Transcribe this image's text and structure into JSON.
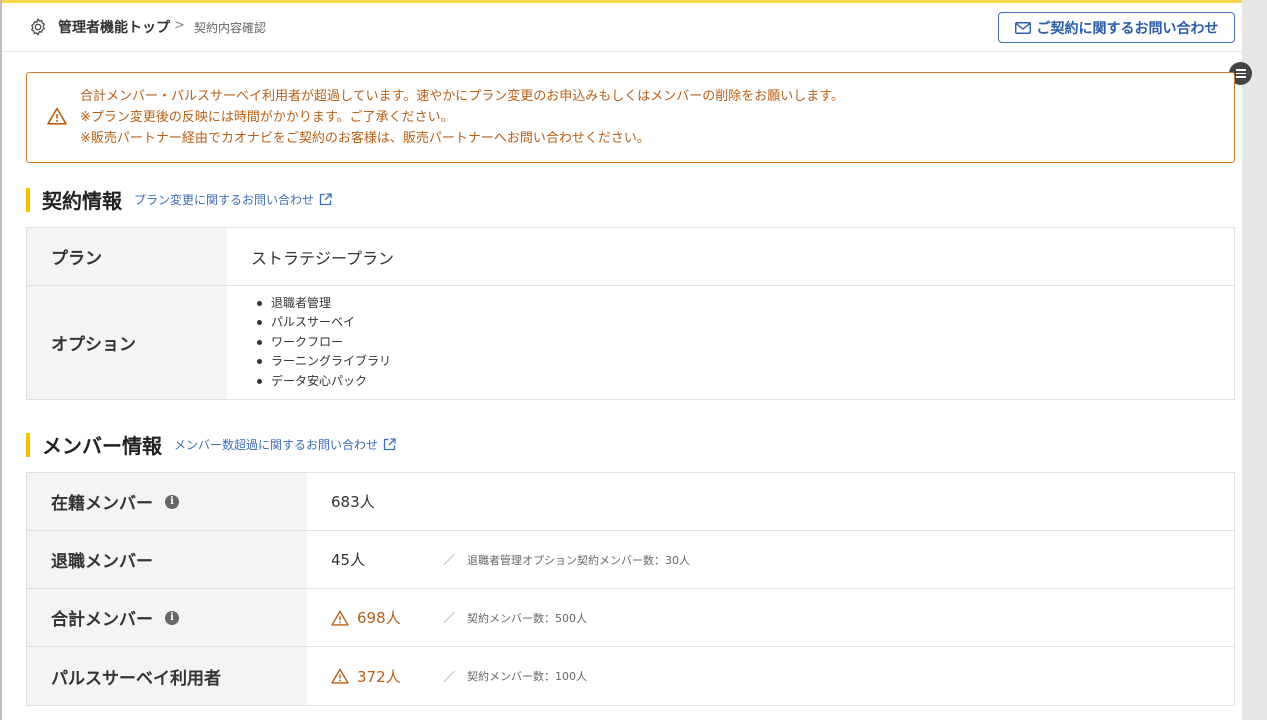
{
  "header": {
    "breadcrumb_root": "管理者機能トップ",
    "breadcrumb_separator": ">",
    "breadcrumb_current": "契約内容確認",
    "contact_button_label": "ご契約に関するお問い合わせ"
  },
  "alert": {
    "lines": [
      "合計メンバー・パルスサーベイ利用者が超過しています。速やかにプラン変更のお申込みもしくはメンバーの削除をお願いします。",
      "※プラン変更後の反映には時間がかかります。ご了承ください。",
      "※販売パートナー経由でカオナビをご契約のお客様は、販売パートナーへお問い合わせください。"
    ]
  },
  "contract": {
    "title": "契約情報",
    "link_label": "プラン変更に関するお問い合わせ",
    "plan_label": "プラン",
    "plan_value": "ストラテジープラン",
    "options_label": "オプション",
    "options": [
      "退職者管理",
      "パルスサーベイ",
      "ワークフロー",
      "ラーニングライブラリ",
      "データ安心パック"
    ]
  },
  "members": {
    "title": "メンバー情報",
    "link_label": "メンバー数超過に関するお問い合わせ",
    "rows": [
      {
        "label": "在籍メンバー",
        "value": "683人"
      },
      {
        "label": "退職メンバー",
        "value": "45人",
        "separator": "／",
        "note": "退職者管理オプション契約メンバー数：30人"
      },
      {
        "label": "合計メンバー",
        "value": "698人",
        "separator": "／",
        "note": "契約メンバー数：500人"
      },
      {
        "label": "パルスサーベイ利用者",
        "value": "372人",
        "separator": "／",
        "note": "契約メンバー数：100人"
      }
    ]
  },
  "colors": {
    "accent_yellow": "#f5c400",
    "warning_orange": "#b85f16",
    "link_blue": "#3d6fb6"
  },
  "icons": [
    "gear-icon",
    "chevron-right-icon",
    "mail-icon",
    "menu-icon",
    "warning-icon",
    "external-link-icon",
    "info-icon"
  ]
}
